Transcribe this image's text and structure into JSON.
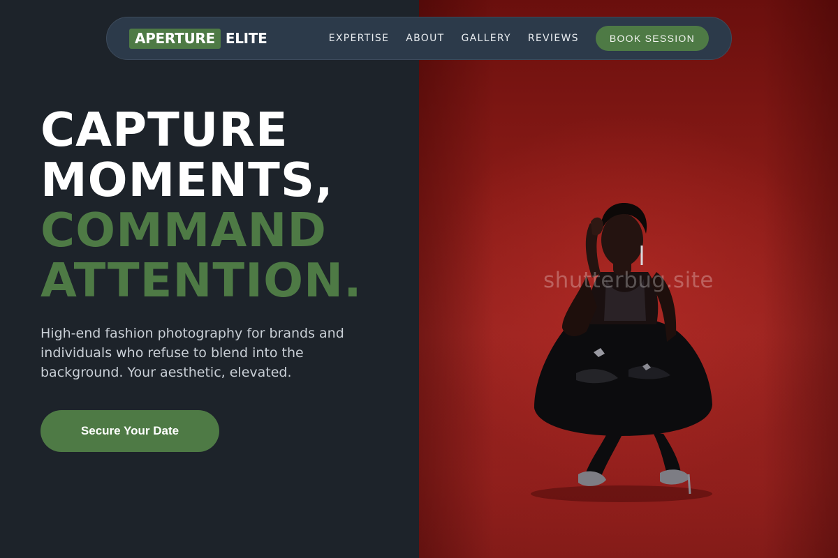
{
  "brand": {
    "badge": "APERTURE",
    "name": "ELITE",
    "accent_color": "#4e7a45"
  },
  "nav": {
    "links": [
      "EXPERTISE",
      "ABOUT",
      "GALLERY",
      "REVIEWS"
    ],
    "book_label": "BOOK SESSION"
  },
  "hero": {
    "headline_white": [
      "CAPTURE",
      "MOMENTS,"
    ],
    "headline_green": [
      "COMMAND",
      "ATTENTION."
    ],
    "subtext": "High-end fashion photography for brands and individuals who refuse to blend into the background. Your aesthetic, elevated.",
    "cta_label": "Secure Your Date"
  },
  "image": {
    "watermark": "shutterbug.site",
    "background_color": "#8a1b17"
  }
}
